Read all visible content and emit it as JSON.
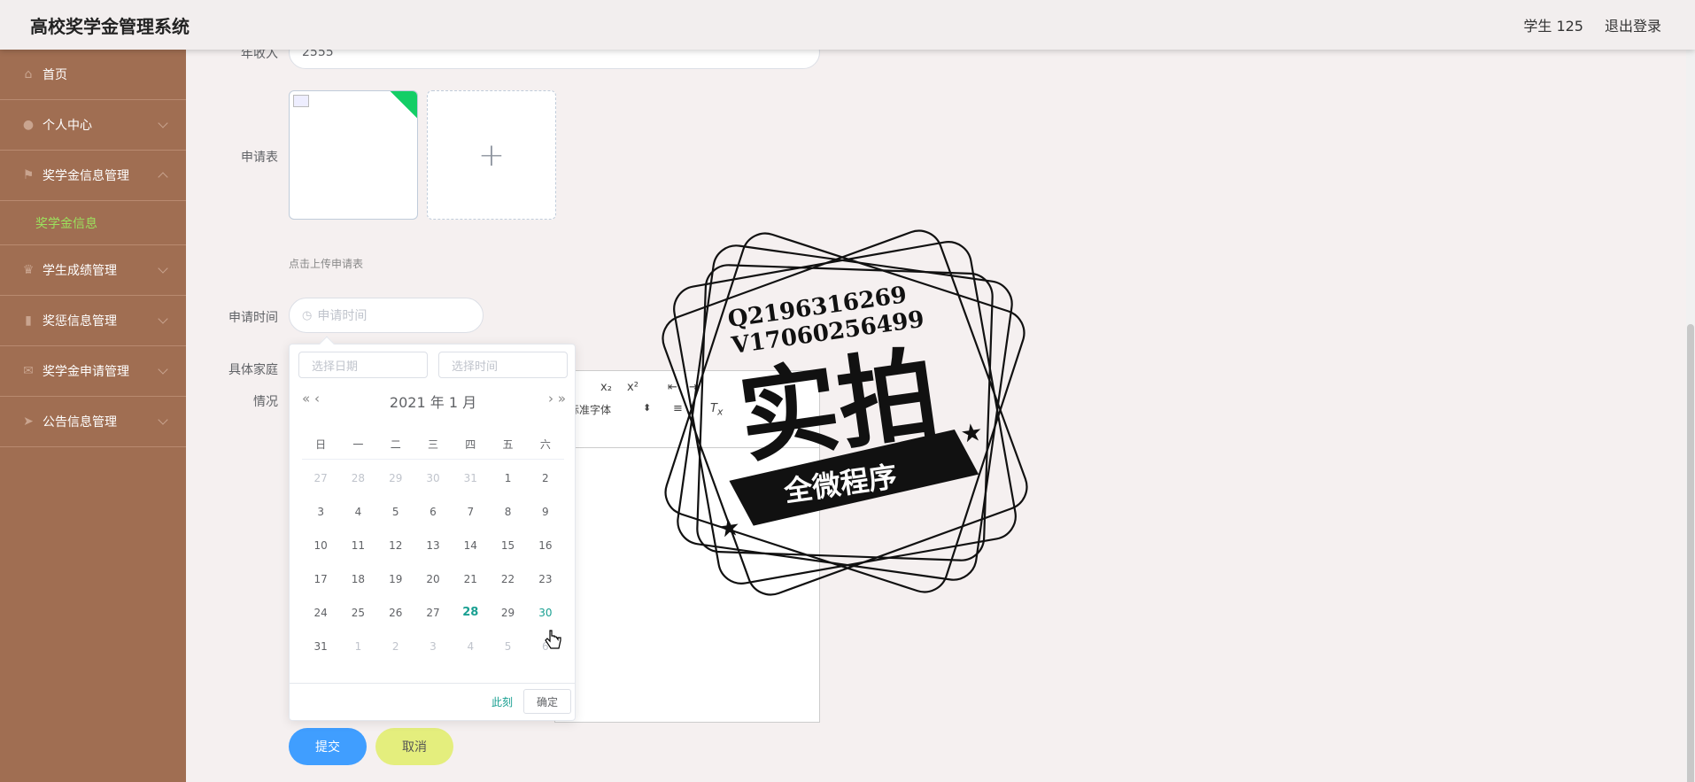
{
  "header": {
    "app_title": "高校奖学金管理系统",
    "user_label": "学生 125",
    "logout_label": "退出登录"
  },
  "sidebar": {
    "items": [
      {
        "label": "首页",
        "icon": "home-icon"
      },
      {
        "label": "个人中心",
        "icon": "user-icon"
      },
      {
        "label": "奖学金信息管理",
        "icon": "flag-icon"
      },
      {
        "label": "奖学金信息",
        "icon": ""
      },
      {
        "label": "学生成绩管理",
        "icon": "trophy-icon"
      },
      {
        "label": "奖惩信息管理",
        "icon": "chart-icon"
      },
      {
        "label": "奖学金申请管理",
        "icon": "mail-icon"
      },
      {
        "label": "公告信息管理",
        "icon": "send-icon"
      }
    ]
  },
  "form": {
    "income_label": "年收入",
    "income_value": "2555",
    "application_label": "申请表",
    "upload_hint": "点击上传申请表",
    "time_label": "申请时间",
    "time_placeholder": "申请时间",
    "family_label_line1": "具体家庭",
    "family_label_line2": "情况",
    "submit_label": "提交",
    "cancel_label": "取消"
  },
  "editor_toolbar": {
    "sub_label": "x₂",
    "sup_label": "x²",
    "font_select": "标准字体"
  },
  "datepicker": {
    "date_placeholder": "选择日期",
    "time_placeholder": "选择时间",
    "year": "2021 年",
    "month": "1 月",
    "weekdays": [
      "日",
      "一",
      "二",
      "三",
      "四",
      "五",
      "六"
    ],
    "weeks": [
      [
        "27",
        "28",
        "29",
        "30",
        "31",
        "1",
        "2"
      ],
      [
        "3",
        "4",
        "5",
        "6",
        "7",
        "8",
        "9"
      ],
      [
        "10",
        "11",
        "12",
        "13",
        "14",
        "15",
        "16"
      ],
      [
        "17",
        "18",
        "19",
        "20",
        "21",
        "22",
        "23"
      ],
      [
        "24",
        "25",
        "26",
        "27",
        "28",
        "29",
        "30"
      ],
      [
        "31",
        "1",
        "2",
        "3",
        "4",
        "5",
        "6"
      ]
    ],
    "today": "28",
    "hovered": "30",
    "now_label": "此刻",
    "ok_label": "确定"
  },
  "watermark": {
    "line1": "Q2196316269",
    "line2": "V17060256499",
    "big_text": "实拍",
    "banner_text": "全微程序"
  },
  "colors": {
    "sidebar_bg": "#a06e52",
    "submenu_active": "#9be15d",
    "primary": "#409eff",
    "cancel_bg": "#e4ee7d",
    "today": "#1aa092"
  }
}
